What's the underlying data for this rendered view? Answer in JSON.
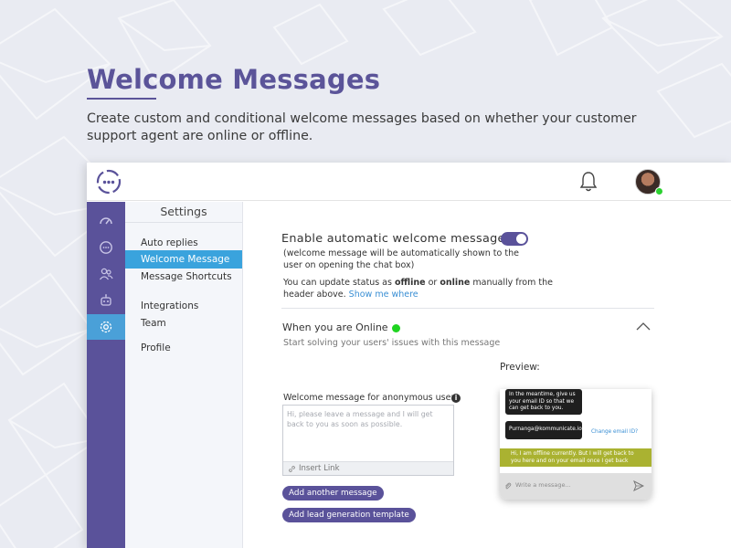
{
  "hero": {
    "title": "Welcome Messages",
    "description": "Create custom and conditional welcome messages based on whether your customer support agent are online or offline."
  },
  "colors": {
    "brand": "#5a529a",
    "active_tab": "#3aa3dd",
    "online": "#1fd421",
    "offline_bubble": "#aab231",
    "background": "#e9ebf2"
  },
  "topbar": {
    "logo_icon": "chat-dots-logo-icon",
    "bell_icon": "bell-icon",
    "avatar": "user-avatar",
    "avatar_status": "online"
  },
  "leftnav": {
    "items": [
      {
        "icon": "dashboard-gauge-icon"
      },
      {
        "icon": "chat-bubble-icon"
      },
      {
        "icon": "users-icon"
      },
      {
        "icon": "bot-icon"
      },
      {
        "icon": "gear-icon",
        "active": true
      }
    ]
  },
  "settings": {
    "title": "Settings",
    "menu": [
      {
        "label": "Auto replies"
      },
      {
        "label": "Welcome Message",
        "active": true
      },
      {
        "label": "Message Shortcuts"
      },
      {
        "label": "Integrations"
      },
      {
        "label": "Team"
      },
      {
        "label": "Profile"
      }
    ]
  },
  "main": {
    "enable_title": "Enable automatic welcome message",
    "toggle_on": true,
    "enable_note": "(welcome message will be automatically shown to the user on opening the chat box)",
    "status_note_1": "You can update status as ",
    "status_offline": "offline",
    "status_or": " or ",
    "status_online": "online",
    "status_note_2": " manually from the header above.",
    "show_me_where": "Show me where",
    "online_title": "When you are Online",
    "online_sub": "Start solving your users' issues with this message",
    "anon_label": "Welcome message for anonymous users",
    "textarea_placeholder": "Hi, please leave a message and I will get back to you as soon as possible.",
    "insert_link": "Insert Link",
    "add_another_message": "Add another message",
    "add_lead_template": "Add lead generation template",
    "preview_label": "Preview:"
  },
  "preview": {
    "bubble1": "In the meantime, give us your email ID so that we can get back to you.",
    "bubble2": "Purnanga@kommunicate.io",
    "change_email": "Change email ID?",
    "offline_message": "Hi, I am offline currently. But I will get back to you here and on your email once I get back",
    "composer_placeholder": "Write a message..."
  }
}
